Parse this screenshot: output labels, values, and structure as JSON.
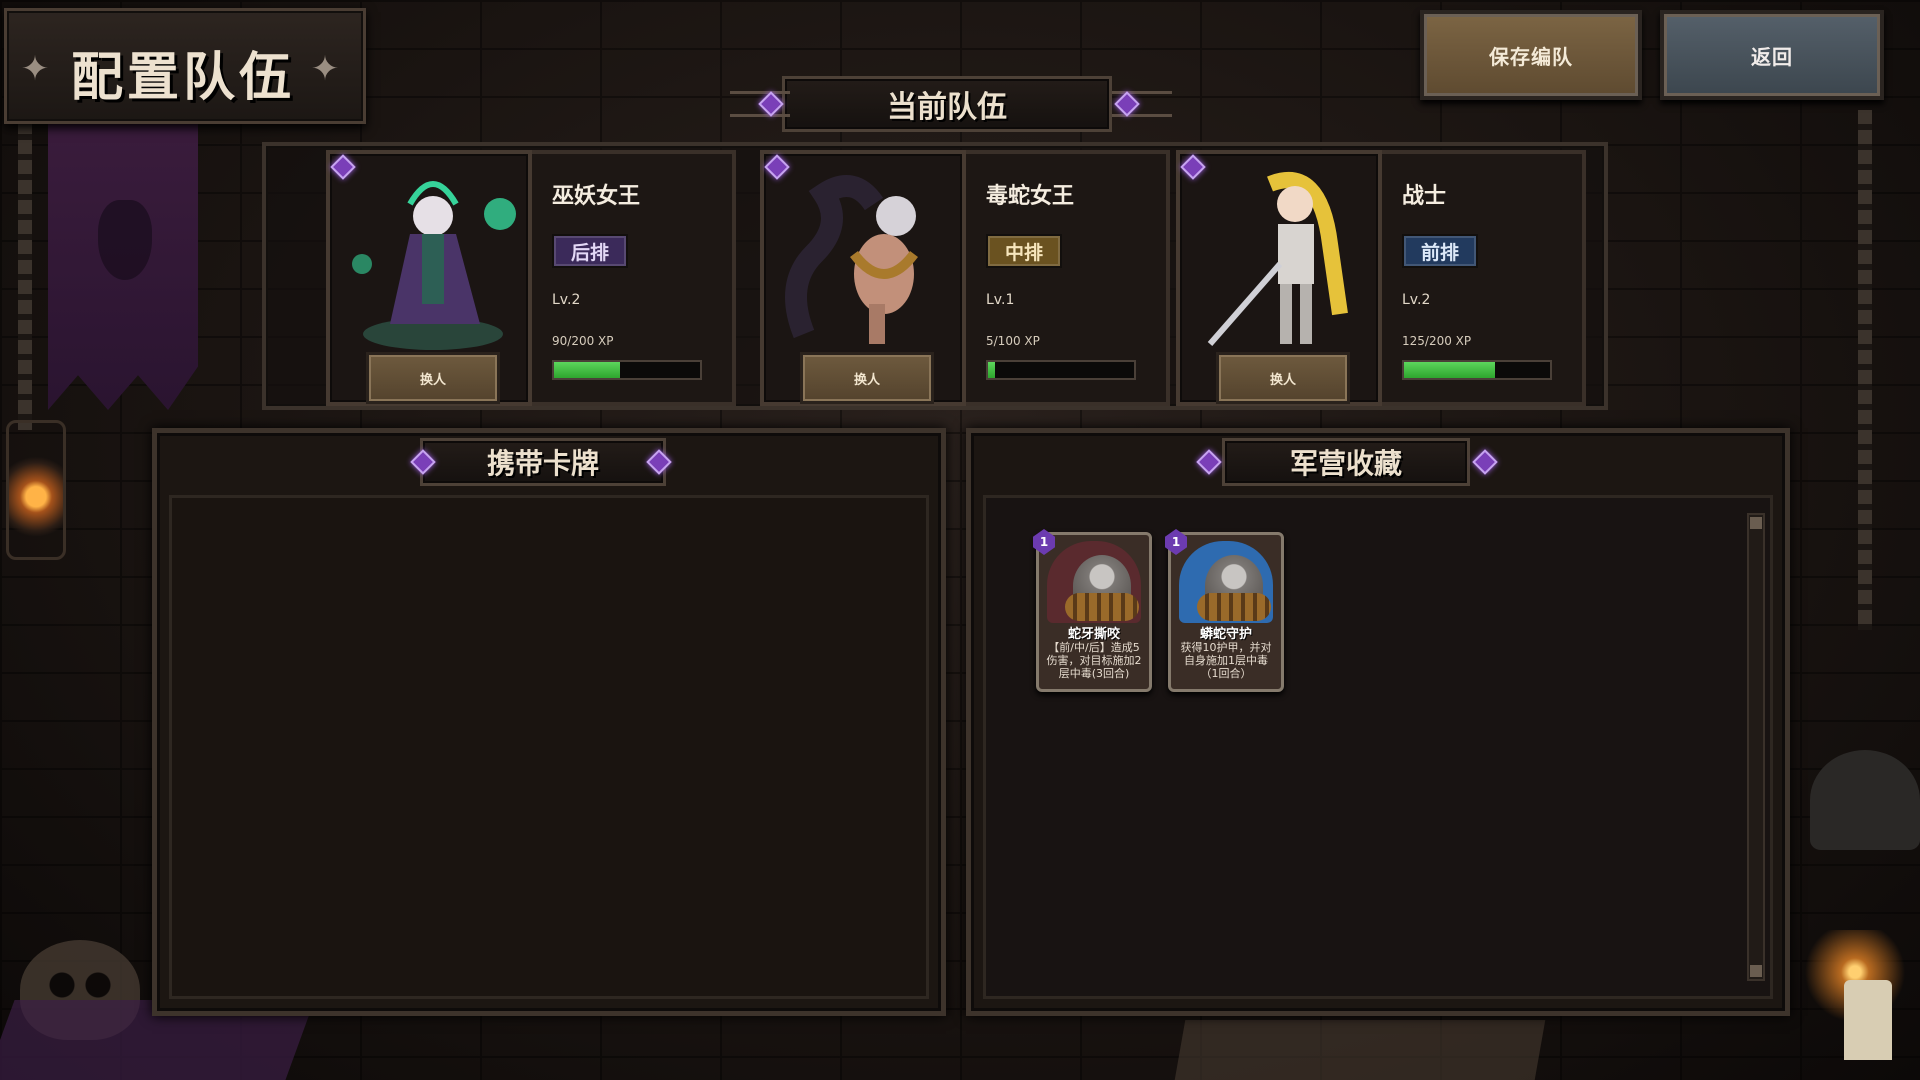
{
  "title": "配置队伍",
  "buttons": {
    "save": "保存编队",
    "back": "返回"
  },
  "current_team_label": "当前队伍",
  "team": [
    {
      "name": "巫妖女王",
      "row": "后排",
      "row_color": "#3b2a5a",
      "level": "Lv.2",
      "xp_text": "90/200 XP",
      "xp_progress": 0.45,
      "swap": "换人",
      "figure_color": "#36d39a"
    },
    {
      "name": "毒蛇女王",
      "row": "中排",
      "row_color": "#6a5220",
      "level": "Lv.1",
      "xp_text": "5/100 XP",
      "xp_progress": 0.05,
      "swap": "换人",
      "figure_color": "#d6a37a"
    },
    {
      "name": "战士",
      "row": "前排",
      "row_color": "#223a5e",
      "level": "Lv.2",
      "xp_text": "125/200 XP",
      "xp_progress": 0.625,
      "swap": "换人",
      "figure_color": "#e6c23a"
    }
  ],
  "panels": {
    "carry": "携带卡牌",
    "barracks": "军营收藏"
  },
  "cards": [
    {
      "name": "蛇牙撕咬",
      "cost": "1",
      "desc": "【前/中/后】造成5伤害，对目标施加2层中毒(3回合)",
      "bg": "#5a2a2e"
    },
    {
      "name": "蟒蛇守护",
      "cost": "1",
      "desc": "获得10护甲，并对自身施加1层中毒（1回合）",
      "bg": "#2e6bb0"
    }
  ]
}
